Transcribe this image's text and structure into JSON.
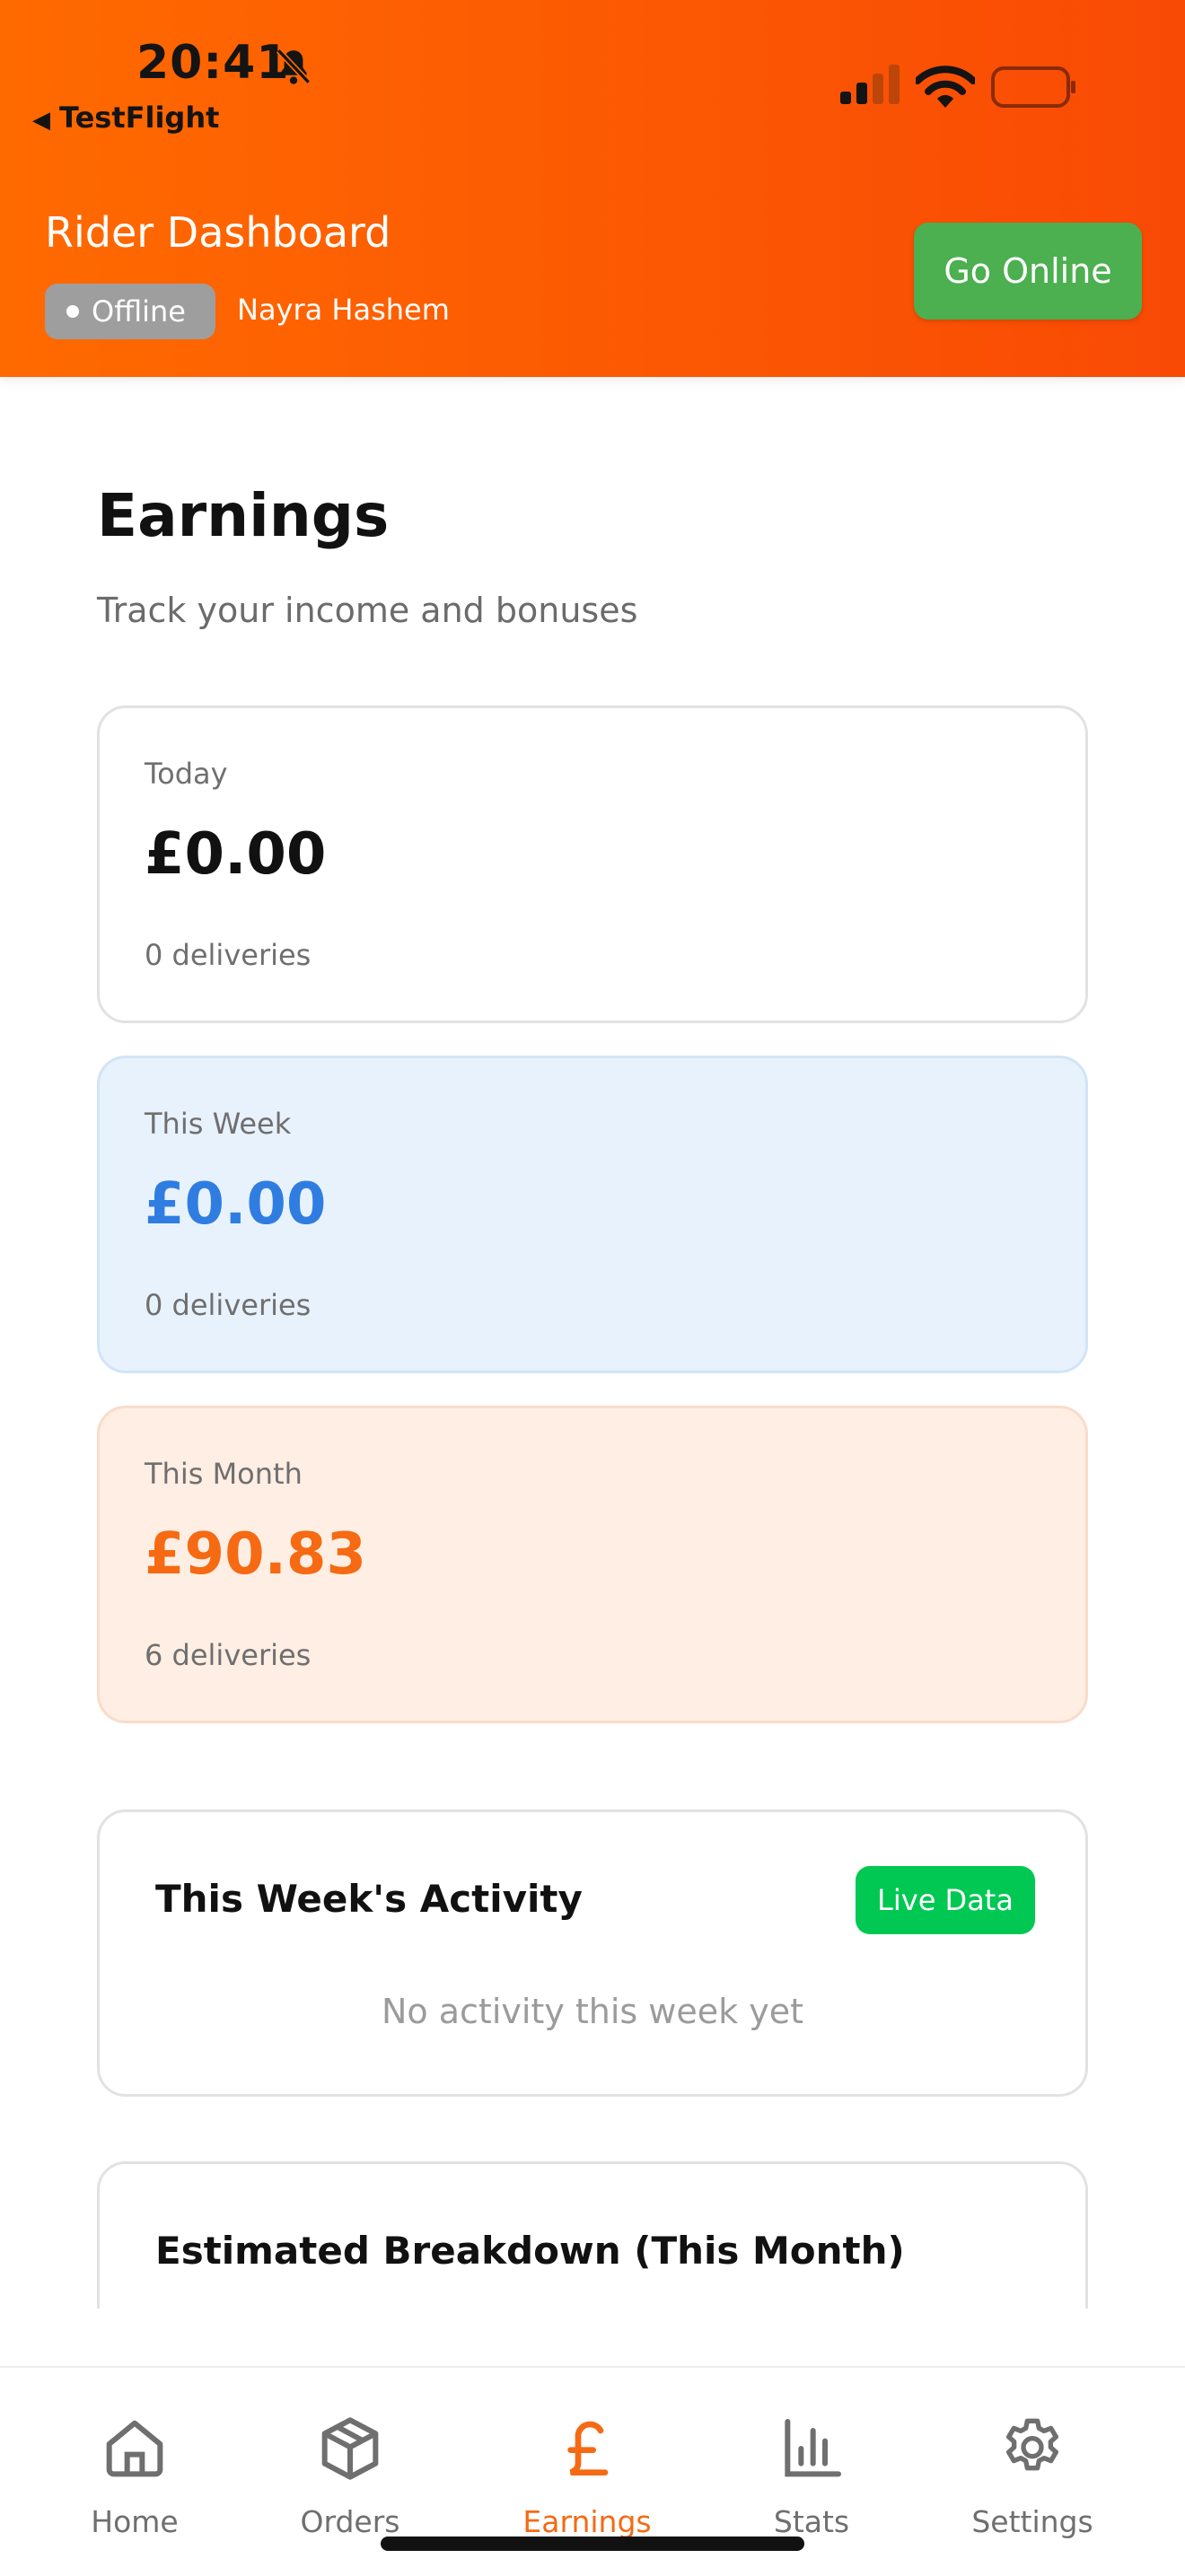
{
  "status_bar": {
    "time": "20:41",
    "back_label": "TestFlight"
  },
  "header": {
    "title": "Rider Dashboard",
    "status": "Offline",
    "rider_name": "Nayra Hashem",
    "action_label": "Go Online"
  },
  "page": {
    "title": "Earnings",
    "subtitle": "Track your income and bonuses"
  },
  "cards": [
    {
      "label": "Today",
      "amount": "£0.00",
      "count": "0 deliveries"
    },
    {
      "label": "This Week",
      "amount": "£0.00",
      "count": "0 deliveries"
    },
    {
      "label": "This Month",
      "amount": "£90.83",
      "count": "6 deliveries"
    }
  ],
  "activity": {
    "title": "This Week's Activity",
    "badge": "Live Data",
    "empty_text": "No activity this week yet"
  },
  "breakdown": {
    "title": "Estimated Breakdown (This Month)"
  },
  "tabs": [
    {
      "label": "Home",
      "icon": "home-icon"
    },
    {
      "label": "Orders",
      "icon": "package-icon"
    },
    {
      "label": "Earnings",
      "icon": "pound-icon"
    },
    {
      "label": "Stats",
      "icon": "bar-chart-icon"
    },
    {
      "label": "Settings",
      "icon": "gear-icon"
    }
  ],
  "colors": {
    "header_start": "#ff6a00",
    "header_end": "#f94a05",
    "go_online": "#4caf50",
    "offline_badge": "#9e9e9e",
    "week_amount": "#2f7de1",
    "month_amount": "#f56a13",
    "live_badge": "#00c853",
    "active_tab": "#f56a13"
  }
}
